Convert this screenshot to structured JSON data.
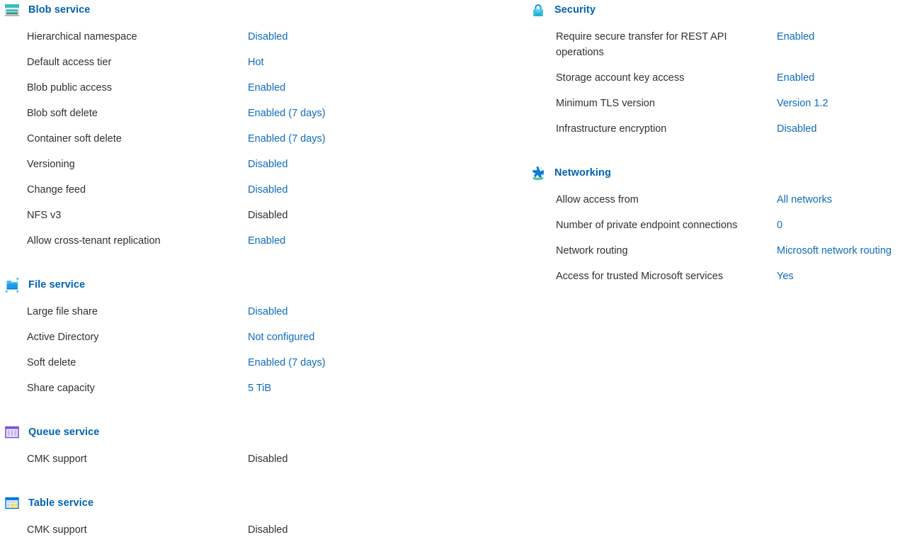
{
  "colors": {
    "link": "#0f6cbd",
    "section_header": "#0063b1",
    "text": "#323130",
    "blob_icon": "#33b5ad",
    "file_icon": "#1e9bf0",
    "queue_icon": "#7b54d0",
    "table_icon": "#0078d4",
    "security_icon": "#32bedd",
    "networking_icon": "#0078d4"
  },
  "left_column": {
    "sections": [
      {
        "id": "blob-service",
        "title": "Blob service",
        "icon": "blob-service-icon",
        "rows": [
          {
            "label": "Hierarchical namespace",
            "value": "Disabled",
            "is_link": true
          },
          {
            "label": "Default access tier",
            "value": "Hot",
            "is_link": true
          },
          {
            "label": "Blob public access",
            "value": "Enabled",
            "is_link": true
          },
          {
            "label": "Blob soft delete",
            "value": "Enabled (7 days)",
            "is_link": true
          },
          {
            "label": "Container soft delete",
            "value": "Enabled (7 days)",
            "is_link": true
          },
          {
            "label": "Versioning",
            "value": "Disabled",
            "is_link": true
          },
          {
            "label": "Change feed",
            "value": "Disabled",
            "is_link": true
          },
          {
            "label": "NFS v3",
            "value": "Disabled",
            "is_link": false
          },
          {
            "label": "Allow cross-tenant replication",
            "value": "Enabled",
            "is_link": true
          }
        ]
      },
      {
        "id": "file-service",
        "title": "File service",
        "icon": "file-service-icon",
        "rows": [
          {
            "label": "Large file share",
            "value": "Disabled",
            "is_link": true
          },
          {
            "label": "Active Directory",
            "value": "Not configured",
            "is_link": true
          },
          {
            "label": "Soft delete",
            "value": "Enabled (7 days)",
            "is_link": true
          },
          {
            "label": "Share capacity",
            "value": "5 TiB",
            "is_link": true
          }
        ]
      },
      {
        "id": "queue-service",
        "title": "Queue service",
        "icon": "queue-service-icon",
        "rows": [
          {
            "label": "CMK support",
            "value": "Disabled",
            "is_link": false
          }
        ]
      },
      {
        "id": "table-service",
        "title": "Table service",
        "icon": "table-service-icon",
        "rows": [
          {
            "label": "CMK support",
            "value": "Disabled",
            "is_link": false
          }
        ]
      }
    ]
  },
  "right_column": {
    "sections": [
      {
        "id": "security",
        "title": "Security",
        "icon": "security-lock-icon",
        "rows": [
          {
            "label": "Require secure transfer for REST API operations",
            "value": "Enabled",
            "is_link": true,
            "tall": true
          },
          {
            "label": "Storage account key access",
            "value": "Enabled",
            "is_link": true
          },
          {
            "label": "Minimum TLS version",
            "value": "Version 1.2",
            "is_link": true
          },
          {
            "label": "Infrastructure encryption",
            "value": "Disabled",
            "is_link": true
          }
        ]
      },
      {
        "id": "networking",
        "title": "Networking",
        "icon": "networking-globe-icon",
        "rows": [
          {
            "label": "Allow access from",
            "value": "All networks",
            "is_link": true
          },
          {
            "label": "Number of private endpoint connections",
            "value": "0",
            "is_link": true
          },
          {
            "label": "Network routing",
            "value": "Microsoft network routing",
            "is_link": true
          },
          {
            "label": "Access for trusted Microsoft services",
            "value": "Yes",
            "is_link": true
          }
        ]
      }
    ]
  }
}
